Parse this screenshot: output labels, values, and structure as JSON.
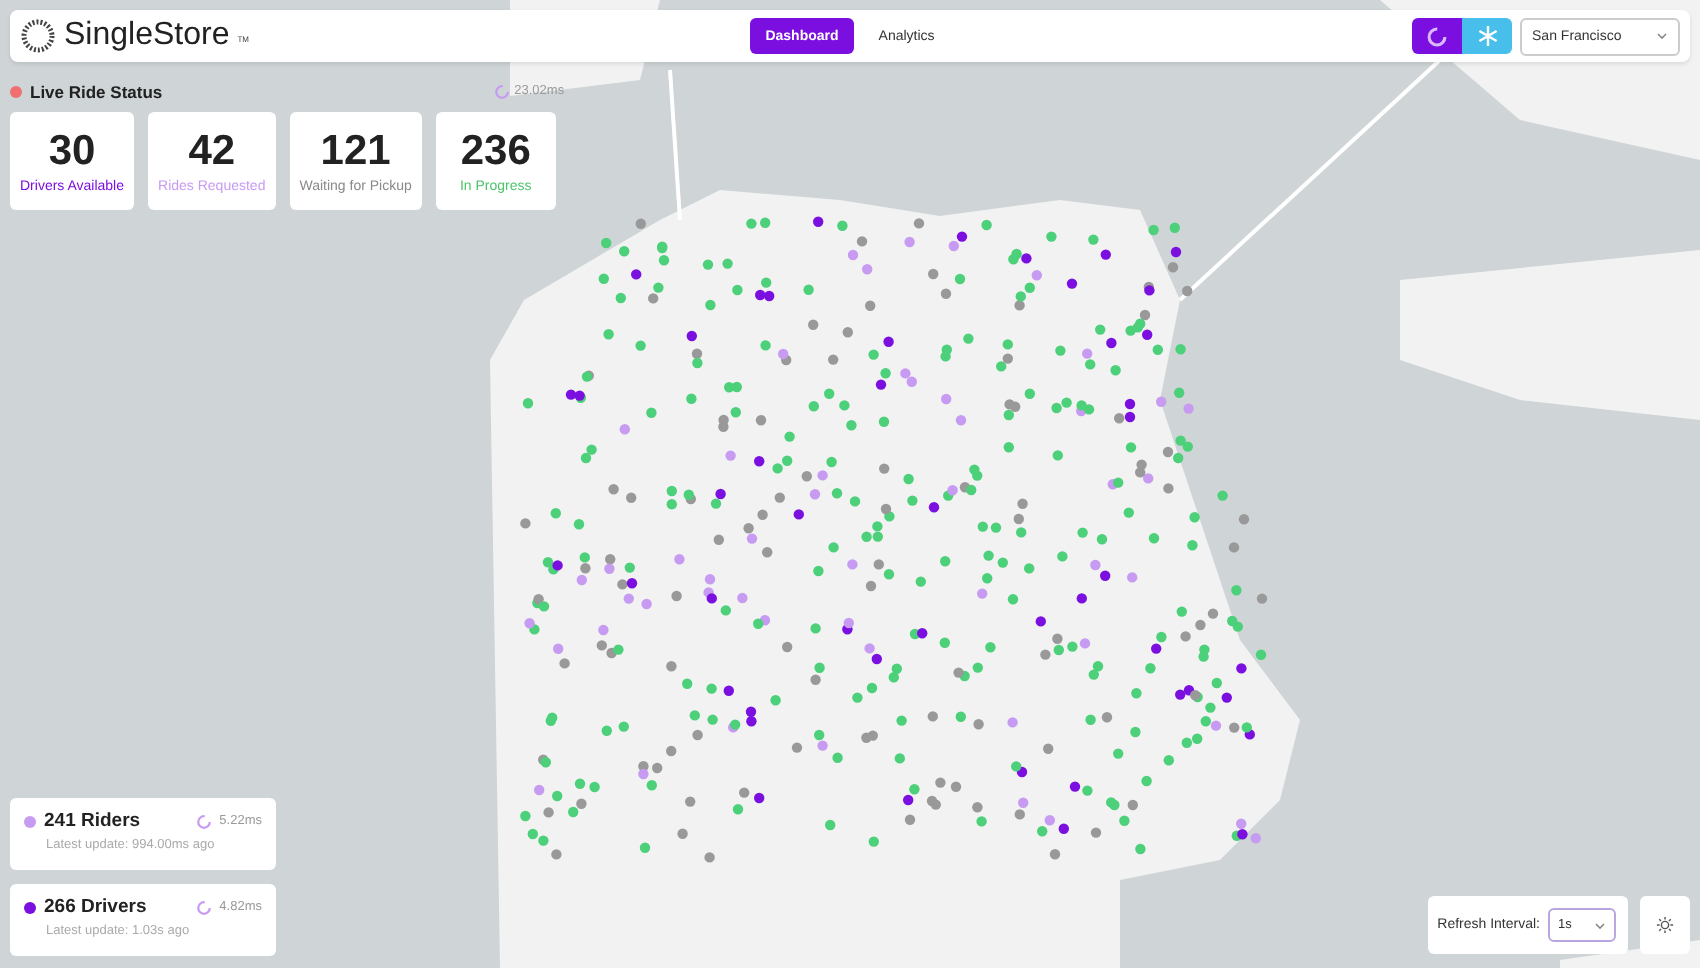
{
  "header": {
    "brand": "SingleStore",
    "brand_mark": "TM",
    "nav": [
      {
        "label": "Dashboard",
        "selected": true
      },
      {
        "label": "Analytics",
        "selected": false
      }
    ],
    "engines": [
      {
        "kind": "singlestore",
        "selected": true
      },
      {
        "kind": "snowflake",
        "selected": false
      }
    ],
    "city_select": {
      "value": "San Francisco"
    }
  },
  "status": {
    "title": "Live Ride Status",
    "latency": "23.02ms"
  },
  "stats": [
    {
      "value": "30",
      "label": "Drivers Available",
      "color": "#7a0fe0"
    },
    {
      "value": "42",
      "label": "Rides Requested",
      "color": "#c79bf2"
    },
    {
      "value": "121",
      "label": "Waiting for Pickup",
      "color": "#8a8a8a"
    },
    {
      "value": "236",
      "label": "In Progress",
      "color": "#4cc46c"
    }
  ],
  "entities": [
    {
      "title": "241 Riders",
      "update": "Latest update: 994.00ms ago",
      "latency": "5.22ms",
      "color": "#c79bf2"
    },
    {
      "title": "266 Drivers",
      "update": "Latest update: 1.03s ago",
      "latency": "4.82ms",
      "color": "#7a0fe0"
    }
  ],
  "refresh": {
    "label": "Refresh Interval:",
    "value": "1s"
  }
}
